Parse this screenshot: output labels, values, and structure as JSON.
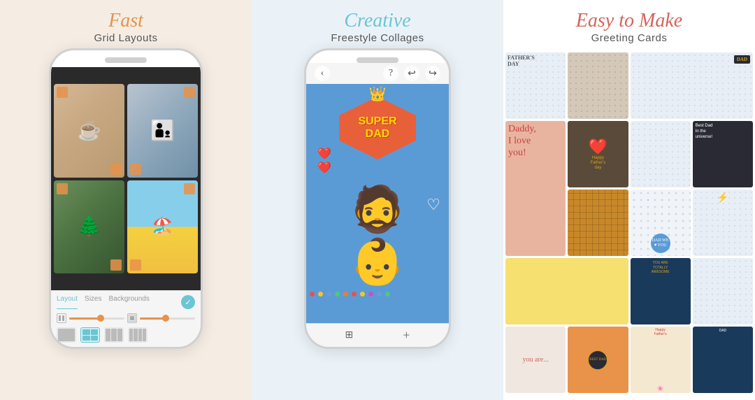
{
  "panels": [
    {
      "id": "left",
      "title_script": "Fast",
      "title_sub": "Grid Layouts",
      "phone": {
        "toolbar_tabs": [
          "Layout",
          "Sizes",
          "Backgrounds"
        ],
        "active_tab": "Layout"
      }
    },
    {
      "id": "center",
      "title_script": "Creative",
      "title_sub": "Freestyle Collages",
      "phone": {
        "super_dad_line1": "SUPER",
        "super_dad_line2": "DAD"
      }
    },
    {
      "id": "right",
      "title_script": "Easy to Make",
      "title_sub": "Greeting Cards"
    }
  ],
  "confetti_colors": [
    "#e85050",
    "#f5c430",
    "#50c878",
    "#6b9bd5",
    "#e88030",
    "#c850c8"
  ],
  "check_mark": "✓",
  "icons": {
    "back": "‹",
    "help": "?",
    "undo": "↩",
    "redo": "↪",
    "add": "+",
    "expand": "⊞"
  }
}
